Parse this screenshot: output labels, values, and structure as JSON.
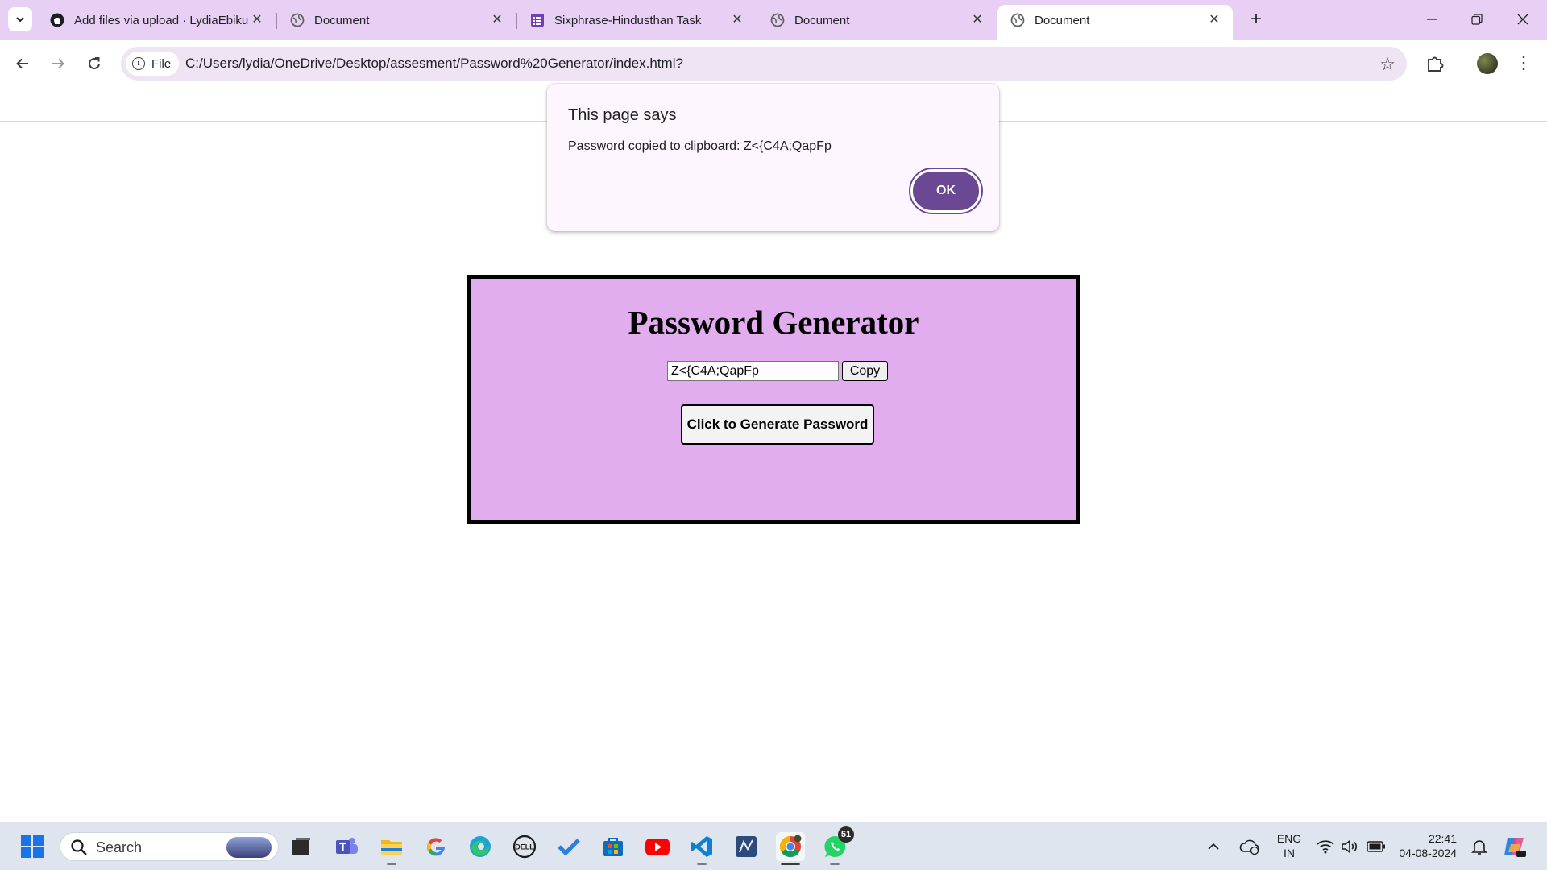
{
  "browser": {
    "tabs": [
      {
        "title": "Add files via upload · LydiaEbiku",
        "icon": "github-icon",
        "active": false
      },
      {
        "title": "Document",
        "icon": "globe-icon",
        "active": false
      },
      {
        "title": "Sixphrase-Hindusthan Task",
        "icon": "form-icon",
        "active": false
      },
      {
        "title": "Document",
        "icon": "globe-icon",
        "active": false
      },
      {
        "title": "Document",
        "icon": "globe-icon",
        "active": true
      }
    ],
    "file_chip_label": "File",
    "url": "C:/Users/lydia/OneDrive/Desktop/assesment/Password%20Generator/index.html?"
  },
  "dialog": {
    "title": "This page says",
    "message": "Password copied to clipboard: Z<{C4A;QapFp",
    "ok_label": "OK"
  },
  "page": {
    "heading": "Password Generator",
    "password_value": "Z<{C4A;QapFp",
    "copy_label": "Copy",
    "generate_label": "Click to Generate Password"
  },
  "taskbar": {
    "search_placeholder": "Search",
    "whatsapp_badge": "51",
    "language_line1": "ENG",
    "language_line2": "IN",
    "time": "22:41",
    "date": "04-08-2024"
  },
  "colors": {
    "tabstrip": "#e8d0f4",
    "card_background": "#e2adef",
    "ok_button": "#6a4893",
    "dialog_background": "#fdf6fe"
  }
}
